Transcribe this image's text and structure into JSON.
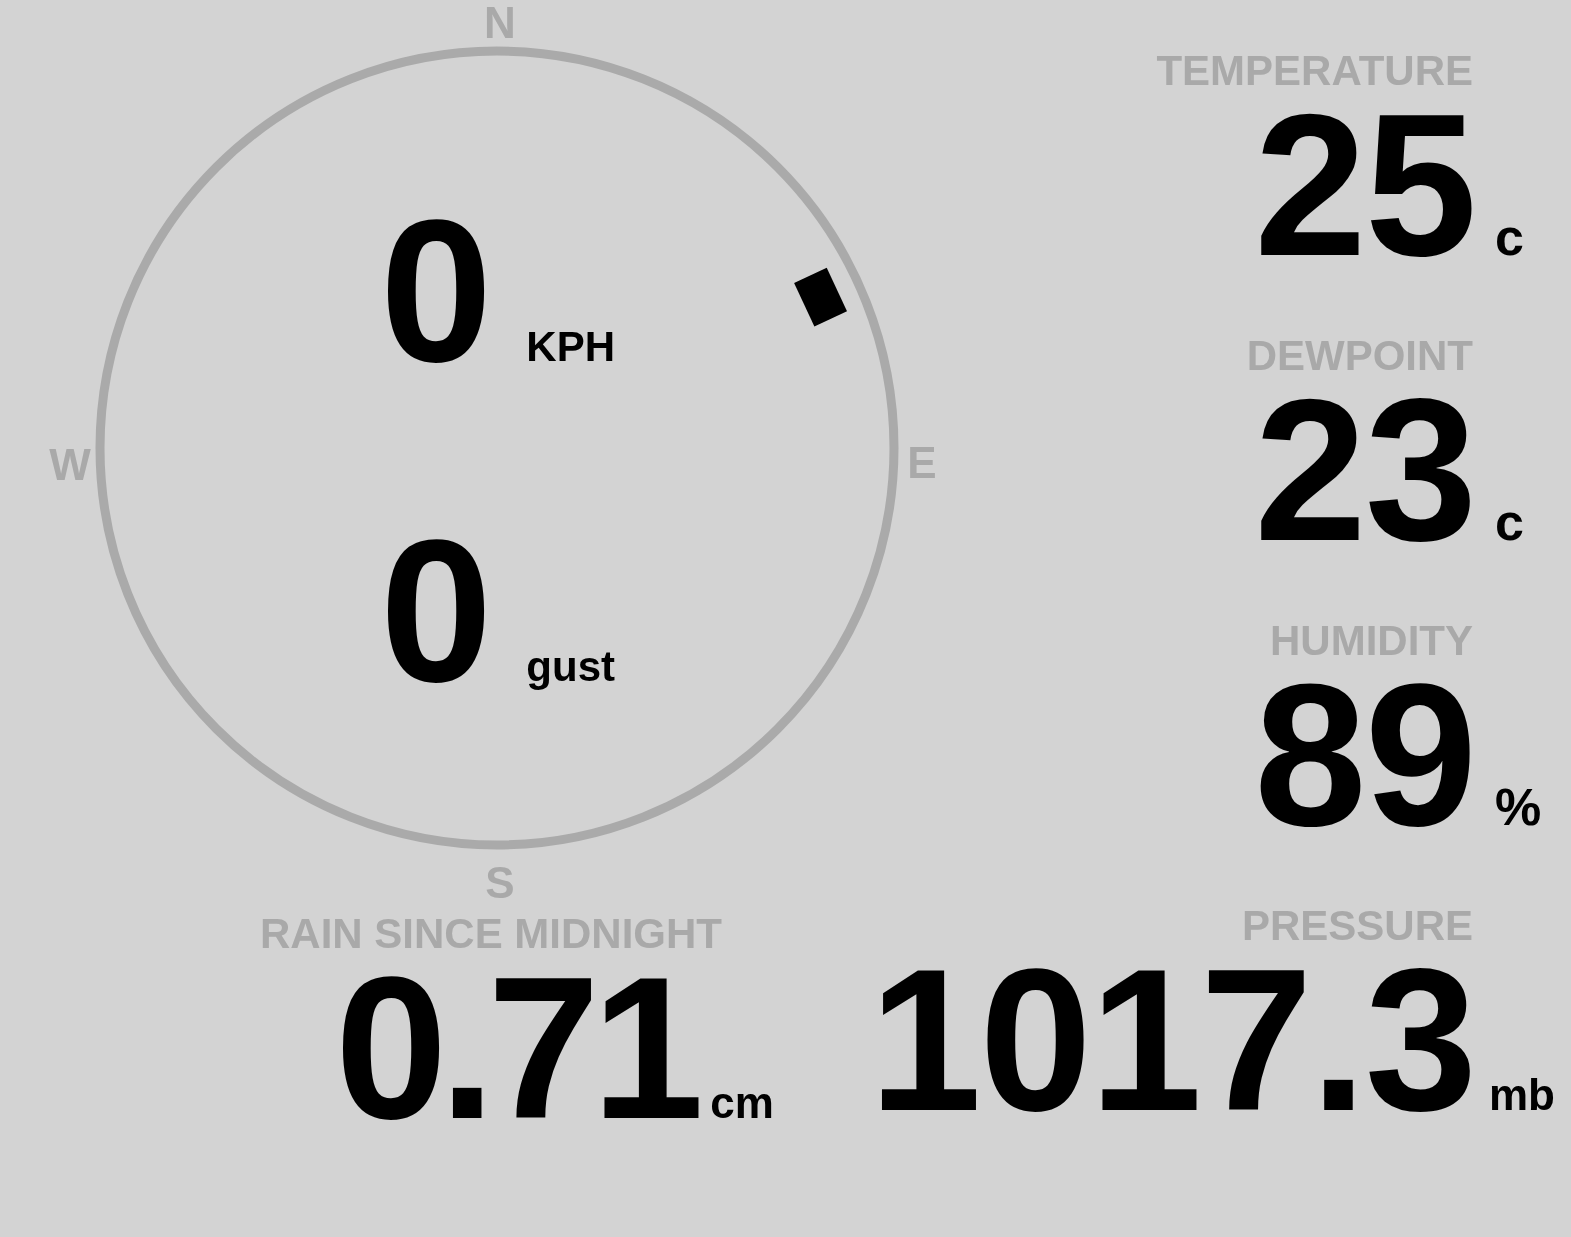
{
  "compass": {
    "north": "N",
    "east": "E",
    "south": "S",
    "west": "W"
  },
  "wind": {
    "speed": "0",
    "speed_unit": "KPH",
    "gust": "0",
    "gust_unit": "gust"
  },
  "readings": [
    {
      "label": "TEMPERATURE",
      "value": "25",
      "unit": "c"
    },
    {
      "label": "DEWPOINT",
      "value": "23",
      "unit": "c"
    },
    {
      "label": "HUMIDITY",
      "value": "89",
      "unit": "%"
    }
  ],
  "rain": {
    "label": "RAIN SINCE MIDNIGHT",
    "value": "0.71",
    "unit": "cm"
  },
  "pressure": {
    "label": "PRESSURE",
    "value": "1017.3",
    "unit": "mb"
  }
}
